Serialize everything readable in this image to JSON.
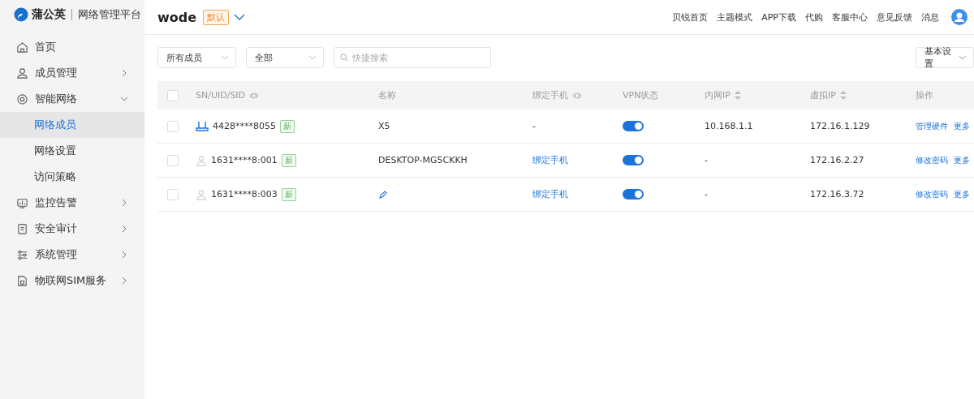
{
  "brand": {
    "name": "蒲公英",
    "product": "网络管理平台"
  },
  "header": {
    "network": "wode",
    "badge": "默认",
    "links": [
      "贝锐首页",
      "主题模式",
      "APP下载",
      "代购",
      "客服中心",
      "意见反馈",
      "消息"
    ]
  },
  "sidebar": {
    "items": [
      {
        "label": "首页"
      },
      {
        "label": "成员管理",
        "expanded": false
      },
      {
        "label": "智能网络",
        "expanded": true,
        "children": [
          {
            "label": "网络成员",
            "selected": true
          },
          {
            "label": "网络设置",
            "selected": false
          },
          {
            "label": "访问策略",
            "selected": false
          }
        ]
      },
      {
        "label": "监控告警",
        "expanded": false
      },
      {
        "label": "安全审计",
        "expanded": false
      },
      {
        "label": "系统管理",
        "expanded": false
      },
      {
        "label": "物联网SIM服务",
        "expanded": false
      }
    ]
  },
  "filters": {
    "member_type": "所有成员",
    "status": "全部",
    "search": {
      "placeholder": "快捷搜索"
    },
    "settings": "基本设置"
  },
  "table": {
    "select_all_checked": false,
    "columns": [
      {
        "label": "SN/UID/SID",
        "eye": true
      },
      {
        "label": "名称"
      },
      {
        "label": "绑定手机",
        "eye": true
      },
      {
        "label": "VPN状态"
      },
      {
        "label": "内网IP",
        "sort": true
      },
      {
        "label": "虚拟IP",
        "sort": true
      },
      {
        "label": "操作"
      }
    ],
    "rows": [
      {
        "kind": "router",
        "checked": false,
        "id": "4428****8055",
        "tag": "新",
        "name": "X5",
        "phone": "-",
        "phone_link": false,
        "vpn_on": true,
        "lan_ip": "10.168.1.1",
        "virtual_ip": "172.16.1.129",
        "actions": [
          "管理硬件",
          "更多"
        ]
      },
      {
        "kind": "user",
        "checked": false,
        "id": "1631****8:001",
        "tag": "新",
        "name": "DESKTOP-MG5CKKH",
        "phone": "绑定手机",
        "phone_link": true,
        "vpn_on": true,
        "lan_ip": "-",
        "virtual_ip": "172.16.2.27",
        "actions": [
          "修改密码",
          "更多"
        ]
      },
      {
        "kind": "user",
        "checked": false,
        "id": "1631****8:003",
        "tag": "新",
        "phone": "绑定手机",
        "phone_link": true,
        "vpn_on": true,
        "lan_ip": "-",
        "virtual_ip": "172.16.3.72",
        "actions": [
          "修改密码",
          "更多"
        ]
      }
    ]
  }
}
